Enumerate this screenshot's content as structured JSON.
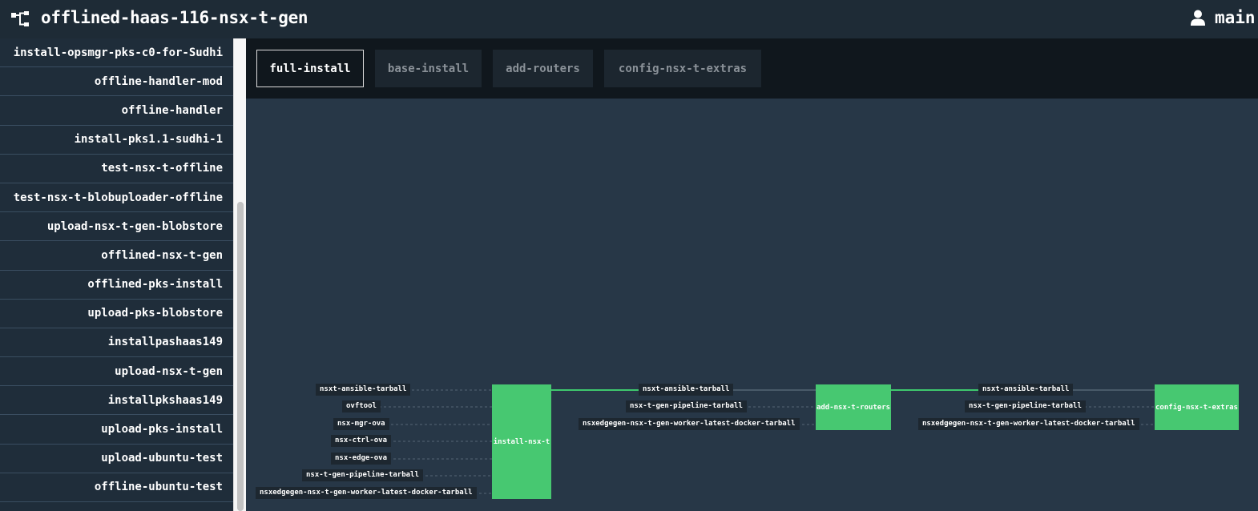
{
  "header": {
    "pipeline_name": "offlined-haas-116-nsx-t-gen",
    "user_label": "main"
  },
  "sidebar": {
    "items": [
      {
        "label": "install-opsmgr-pks-c0-for-Sudhi"
      },
      {
        "label": "offline-handler-mod"
      },
      {
        "label": "offline-handler"
      },
      {
        "label": "install-pks1.1-sudhi-1"
      },
      {
        "label": "test-nsx-t-offline"
      },
      {
        "label": "test-nsx-t-blobuploader-offline"
      },
      {
        "label": "upload-nsx-t-gen-blobstore"
      },
      {
        "label": "offlined-nsx-t-gen"
      },
      {
        "label": "offlined-pks-install"
      },
      {
        "label": "upload-pks-blobstore"
      },
      {
        "label": "installpashaas149"
      },
      {
        "label": "upload-nsx-t-gen"
      },
      {
        "label": "installpkshaas149"
      },
      {
        "label": "upload-pks-install"
      },
      {
        "label": "upload-ubuntu-test"
      },
      {
        "label": "offline-ubuntu-test"
      },
      {
        "label": ""
      }
    ]
  },
  "groups": [
    {
      "label": "full-install",
      "active": true
    },
    {
      "label": "base-install",
      "active": false
    },
    {
      "label": "add-routers",
      "active": false
    },
    {
      "label": "config-nsx-t-extras",
      "active": false
    }
  ],
  "graph": {
    "colors": {
      "job": "#47c871",
      "link": "#3ec86d",
      "label_bg": "#1d2730",
      "dashed": "#556675"
    },
    "job1": {
      "name": "install-nsx-t",
      "inputs": [
        {
          "name": "nsxt-ansible-tarball"
        },
        {
          "name": "ovftool"
        },
        {
          "name": "nsx-mgr-ova"
        },
        {
          "name": "nsx-ctrl-ova"
        },
        {
          "name": "nsx-edge-ova"
        },
        {
          "name": "nsx-t-gen-pipeline-tarball"
        },
        {
          "name": "nsxedgegen-nsx-t-gen-worker-latest-docker-tarball"
        }
      ]
    },
    "job2": {
      "name": "add-nsx-t-routers",
      "inputs": [
        {
          "name": "nsxt-ansible-tarball"
        },
        {
          "name": "nsx-t-gen-pipeline-tarball"
        },
        {
          "name": "nsxedgegen-nsx-t-gen-worker-latest-docker-tarball"
        }
      ]
    },
    "job3": {
      "name": "config-nsx-t-extras",
      "inputs": [
        {
          "name": "nsxt-ansible-tarball"
        },
        {
          "name": "nsx-t-gen-pipeline-tarball"
        },
        {
          "name": "nsxedgegen-nsx-t-gen-worker-latest-docker-tarball"
        }
      ]
    }
  }
}
